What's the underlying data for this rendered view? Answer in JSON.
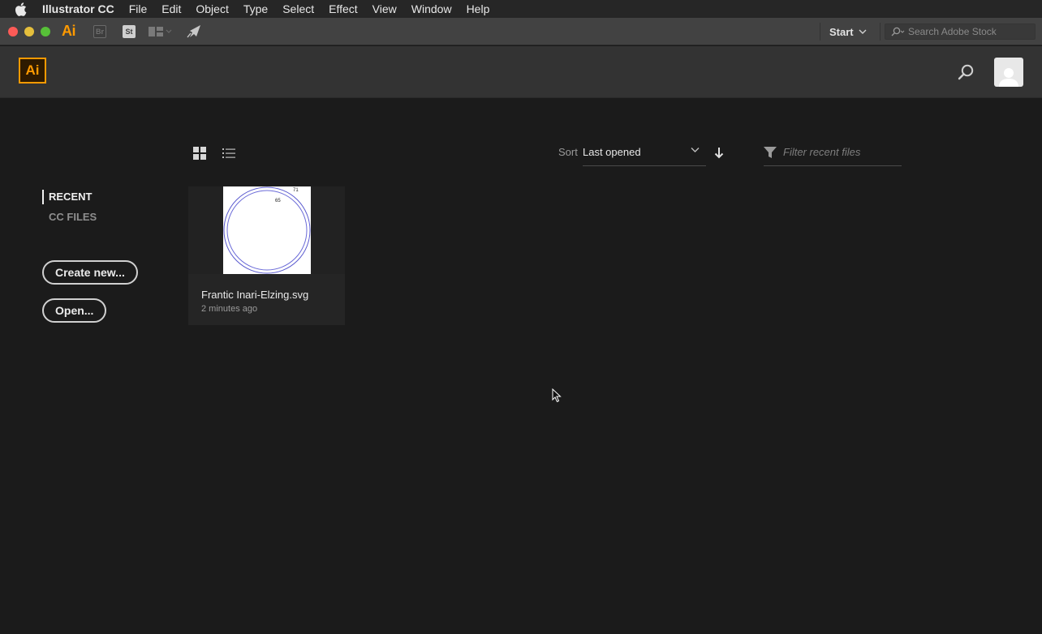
{
  "menubar": {
    "app_name": "Illustrator CC",
    "items": [
      "File",
      "Edit",
      "Object",
      "Type",
      "Select",
      "Effect",
      "View",
      "Window",
      "Help"
    ]
  },
  "titlebar": {
    "ai_label": "Ai",
    "br_label": "Br",
    "st_label": "St",
    "workspace_label": "Start",
    "stock_search_placeholder": "Search Adobe Stock"
  },
  "header": {
    "logo_label": "Ai"
  },
  "sidebar": {
    "nav": [
      {
        "label": "RECENT",
        "active": true
      },
      {
        "label": "CC FILES",
        "active": false
      }
    ],
    "create_label": "Create new...",
    "open_label": "Open..."
  },
  "toolbar": {
    "sort_label": "Sort",
    "sort_value": "Last opened",
    "filter_placeholder": "Filter recent files"
  },
  "files": [
    {
      "name": "Frantic Inari-Elzing.svg",
      "time": "2 minutes ago",
      "thumb_labels": [
        "65",
        "71"
      ]
    }
  ],
  "colors": {
    "accent": "#ff9a00",
    "background": "#1b1b1b",
    "header": "#333333"
  }
}
